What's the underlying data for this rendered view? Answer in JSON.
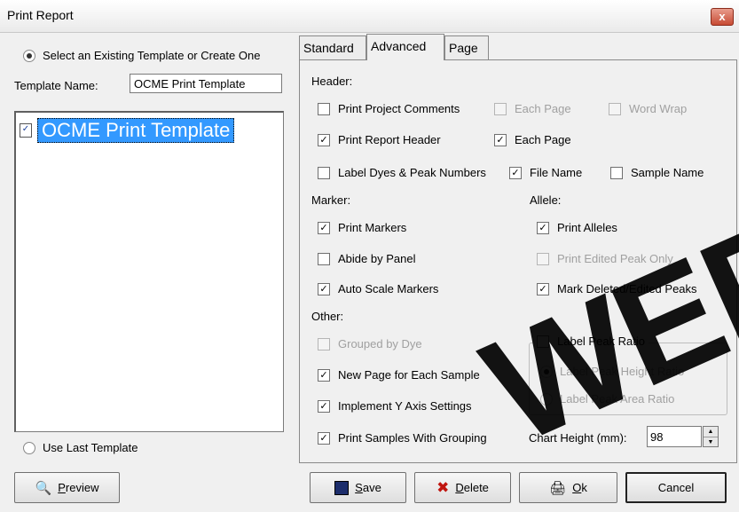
{
  "window": {
    "title": "Print Report",
    "close": "x"
  },
  "left": {
    "select_existing": "Select an Existing Template or Create One",
    "template_name_label": "Template Name:",
    "template_name_value": "OCME Print Template",
    "tree_items": [
      "OCME Print Template"
    ],
    "use_last": "Use Last Template"
  },
  "tabs": [
    "Standard",
    "Advanced",
    "Page"
  ],
  "active_tab": "Advanced",
  "header": {
    "label": "Header:",
    "print_project_comments": "Print Project Comments",
    "each_page_1": "Each Page",
    "word_wrap": "Word Wrap",
    "print_report_header": "Print Report Header",
    "each_page_2": "Each Page",
    "label_dyes": "Label Dyes & Peak Numbers",
    "file_name": "File Name",
    "sample_name": "Sample Name"
  },
  "marker": {
    "label": "Marker:",
    "print_markers": "Print Markers",
    "abide_by_panel": "Abide by Panel",
    "auto_scale": "Auto Scale Markers"
  },
  "allele": {
    "label": "Allele:",
    "print_alleles": "Print Alleles",
    "print_edited_only": "Print Edited Peak Only",
    "mark_deleted": "Mark Deleted/Edited Peaks"
  },
  "other": {
    "label": "Other:",
    "grouped_by_dye": "Grouped by Dye",
    "new_page": "New Page for Each Sample",
    "implement_y": "Implement  Y Axis Settings",
    "print_samples_grouping": "Print Samples With Grouping"
  },
  "peak_ratio": {
    "label": "Label Peak Ratio",
    "height": "Label Peak Height Ratio",
    "area": "Label Peak Area Ratio"
  },
  "chart_height": {
    "label": "Chart Height (mm):",
    "value": "98"
  },
  "buttons": {
    "preview_u": "P",
    "preview_rest": "review",
    "save_u": "S",
    "save_rest": "ave",
    "delete_u": "D",
    "delete_rest": "elete",
    "ok_u": "O",
    "ok_rest": "k",
    "cancel": "Cancel"
  },
  "watermark": "WED"
}
